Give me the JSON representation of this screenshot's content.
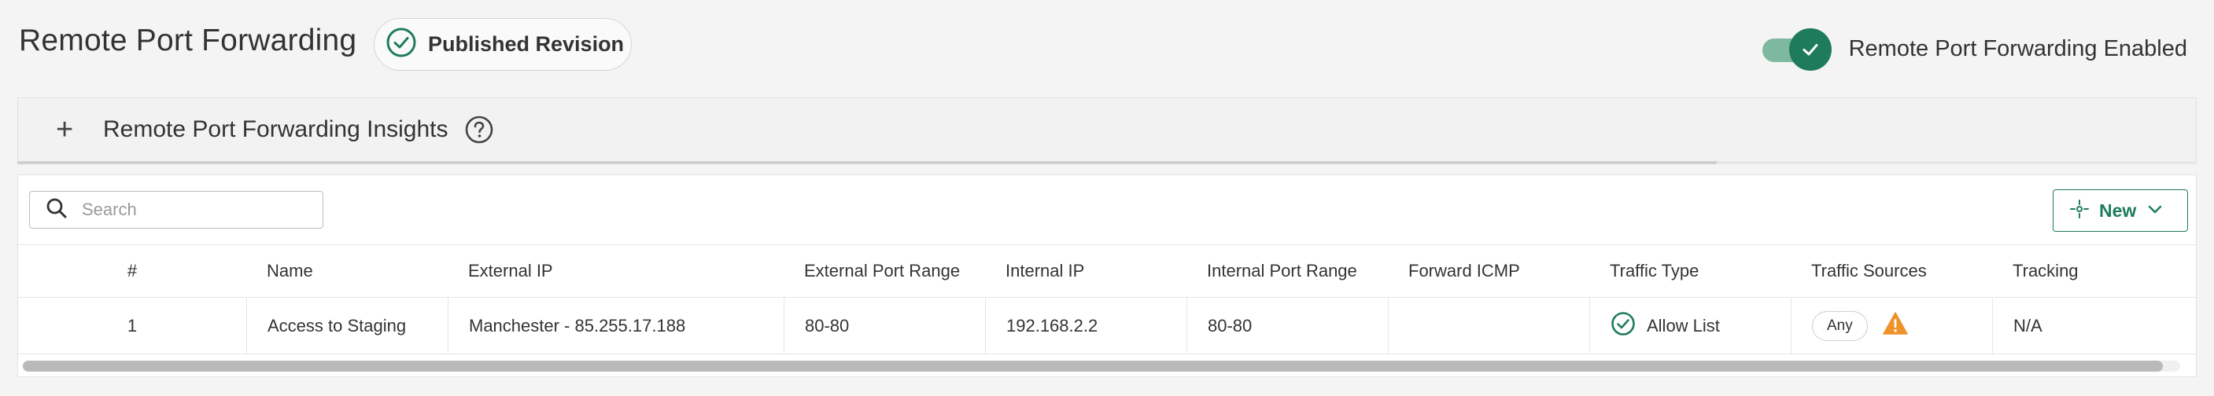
{
  "header": {
    "title": "Remote Port Forwarding",
    "badge_label": "Published Revision",
    "toggle_label": "Remote Port Forwarding Enabled",
    "toggle_on": true
  },
  "insights": {
    "label": "Remote Port Forwarding Insights",
    "expand_icon": "plus-icon",
    "help_icon": "question-circle-icon"
  },
  "toolbar": {
    "search_placeholder": "Search",
    "search_value": "",
    "new_label": "New"
  },
  "table": {
    "columns": [
      "#",
      "Name",
      "External IP",
      "External Port Range",
      "Internal IP",
      "Internal Port Range",
      "Forward ICMP",
      "Traffic Type",
      "Traffic Sources",
      "Tracking"
    ],
    "rows": [
      {
        "num": "1",
        "name": "Access to Staging",
        "external_ip": "Manchester - 85.255.17.188",
        "external_port_range": "80-80",
        "internal_ip": "192.168.2.2",
        "internal_port_range": "80-80",
        "forward_icmp": "",
        "traffic_type": "Allow List",
        "traffic_sources": "Any",
        "tracking": "N/A"
      }
    ]
  },
  "colors": {
    "accent": "#1e7b5c",
    "toggle_track": "#7fb8a1",
    "warning": "#f0922b"
  }
}
